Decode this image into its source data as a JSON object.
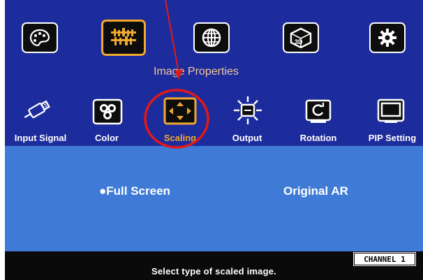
{
  "colors": {
    "top_panel": "#1d2c9c",
    "options_panel": "#3f7bd6",
    "selected_border": "#f0a830",
    "title_text": "#f2c79a",
    "annotation_red": "#e31818"
  },
  "top_menu": [
    {
      "icon": "palette-icon"
    },
    {
      "icon": "image-properties-icon",
      "selected": true
    },
    {
      "icon": "globe-icon"
    },
    {
      "icon": "3d-cube-icon"
    },
    {
      "icon": "gear-icon"
    }
  ],
  "menu_title": "Image Properties",
  "submenu": [
    {
      "label": "Input Signal",
      "icon": "usb-plug-icon"
    },
    {
      "label": "Color",
      "icon": "color-icon"
    },
    {
      "label": "Scaling",
      "icon": "scaling-icon",
      "selected": true
    },
    {
      "label": "Output",
      "icon": "sun-output-icon"
    },
    {
      "label": "Rotation",
      "icon": "rotation-icon"
    },
    {
      "label": "PIP Setting",
      "icon": "pip-icon"
    }
  ],
  "options": {
    "full_screen": "●Full Screen",
    "original_ar": "Original AR",
    "selected": "Full Screen"
  },
  "status": {
    "hint": "Select type of scaled image.",
    "channel": "CHANNEL 1"
  }
}
